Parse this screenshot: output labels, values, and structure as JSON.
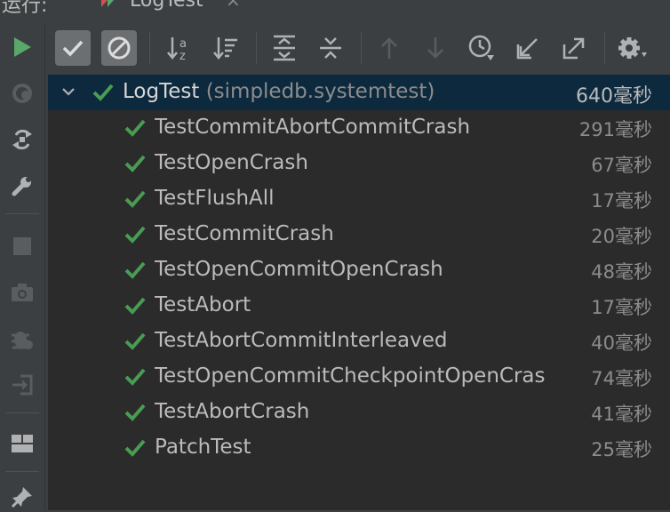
{
  "header": {
    "label": "运行:",
    "tab_label": "LogTest",
    "tab_close": "×"
  },
  "toolbar": {
    "buttons": [
      {
        "name": "show-passed-toggle",
        "icon": "check-icon",
        "active": true
      },
      {
        "name": "show-ignored-toggle",
        "icon": "prohibit-icon",
        "active": true
      },
      {
        "name": "sort-alphabetically-button",
        "icon": "sort-alpha-icon"
      },
      {
        "name": "sort-by-duration-button",
        "icon": "sort-duration-icon"
      },
      {
        "name": "expand-all-button",
        "icon": "expand-all-icon"
      },
      {
        "name": "collapse-all-button",
        "icon": "collapse-all-icon"
      },
      {
        "name": "previous-failed-button",
        "icon": "arrow-up-icon",
        "disabled": true
      },
      {
        "name": "next-failed-button",
        "icon": "arrow-down-icon",
        "disabled": true
      },
      {
        "name": "test-history-button",
        "icon": "clock-icon"
      },
      {
        "name": "import-tests-button",
        "icon": "import-icon"
      },
      {
        "name": "export-tests-button",
        "icon": "export-icon"
      },
      {
        "name": "settings-button",
        "icon": "gear-icon"
      }
    ]
  },
  "left_toolbar": {
    "icons": [
      "play-icon",
      "rerun-failed-icon",
      "toggle-auto-test-icon",
      "wrench-icon",
      "stop-icon",
      "camera-icon",
      "debug-icon",
      "exit-icon",
      "layout-icon",
      "pin-icon"
    ]
  },
  "tree": {
    "root": {
      "name": "LogTest",
      "package": "(simpledb.systemtest)",
      "time": "640毫秒",
      "status": "passed"
    },
    "tests": [
      {
        "name": "TestCommitAbortCommitCrash",
        "time": "291毫秒"
      },
      {
        "name": "TestOpenCrash",
        "time": "67毫秒"
      },
      {
        "name": "TestFlushAll",
        "time": "17毫秒"
      },
      {
        "name": "TestCommitCrash",
        "time": "20毫秒"
      },
      {
        "name": "TestOpenCommitOpenCrash",
        "time": "48毫秒"
      },
      {
        "name": "TestAbort",
        "time": "17毫秒"
      },
      {
        "name": "TestAbortCommitInterleaved",
        "time": "40毫秒"
      },
      {
        "name": "TestOpenCommitCheckpointOpenCras",
        "time": "74毫秒"
      },
      {
        "name": "TestAbortCrash",
        "time": "41毫秒"
      },
      {
        "name": "PatchTest",
        "time": "25毫秒"
      }
    ]
  },
  "colors": {
    "pass": "#499c54",
    "play": "#59a869",
    "selection": "#0d293e",
    "tree_bg": "#2b2b2b",
    "toolbar_bg": "#3c3f41"
  }
}
